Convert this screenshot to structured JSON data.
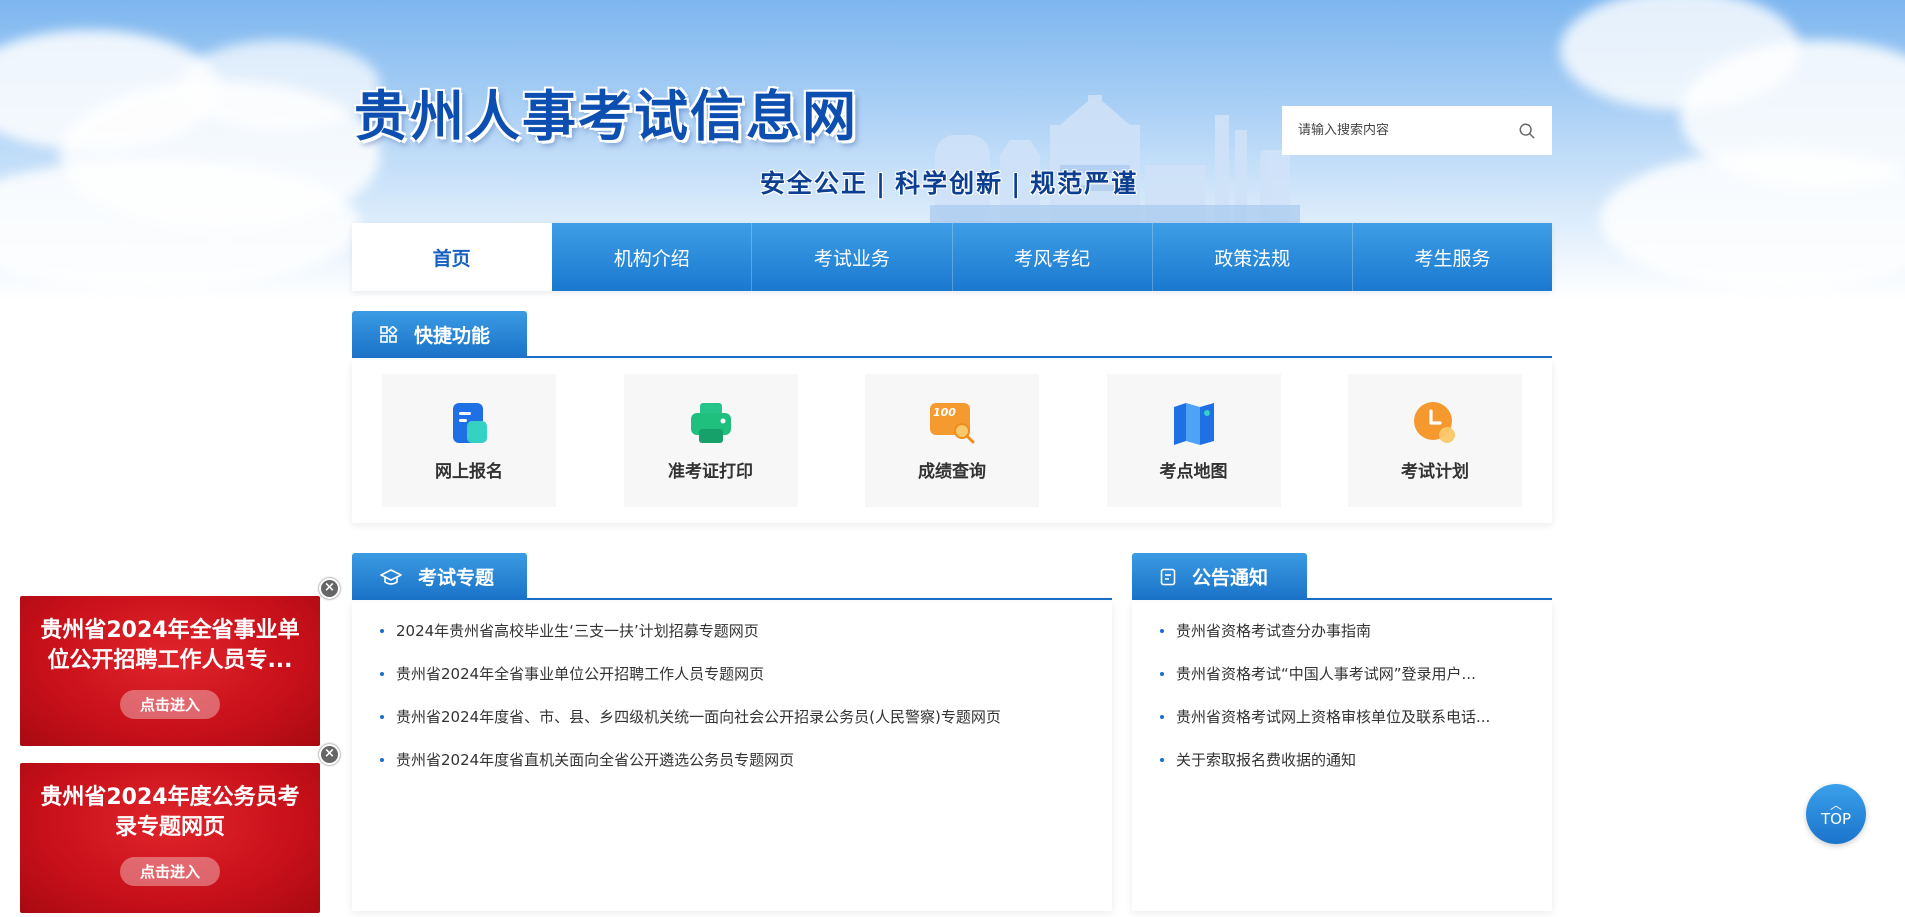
{
  "header": {
    "site_title": "贵州人事考试信息网",
    "slogan_1": "安全公正",
    "slogan_2": "科学创新",
    "slogan_3": "规范严谨",
    "slogan_sep": "|"
  },
  "search": {
    "placeholder": "请输入搜索内容",
    "icon": "search-icon"
  },
  "nav": {
    "items": [
      {
        "label": "首页",
        "active": true
      },
      {
        "label": "机构介绍"
      },
      {
        "label": "考试业务"
      },
      {
        "label": "考风考纪"
      },
      {
        "label": "政策法规"
      },
      {
        "label": "考生服务"
      }
    ]
  },
  "quick": {
    "title": "快捷功能",
    "icon": "grid-icon",
    "items": [
      {
        "label": "网上报名",
        "icon": "signup-icon"
      },
      {
        "label": "准考证打印",
        "icon": "printer-icon"
      },
      {
        "label": "成绩查询",
        "icon": "score-search-icon",
        "badge": "100"
      },
      {
        "label": "考点地图",
        "icon": "map-icon"
      },
      {
        "label": "考试计划",
        "icon": "clock-icon"
      }
    ]
  },
  "topics": {
    "title": "考试专题",
    "icon": "graduation-cap-icon",
    "items": [
      "2024年贵州省高校毕业生‘三支一扶’计划招募专题网页",
      "贵州省2024年全省事业单位公开招聘工作人员专题网页",
      "贵州省2024年度省、市、县、乡四级机关统一面向社会公开招录公务员(人民警察)专题网页",
      "贵州省2024年度省直机关面向全省公开遴选公务员专题网页"
    ]
  },
  "notices": {
    "title": "公告通知",
    "icon": "document-icon",
    "items": [
      "贵州省资格考试查分办事指南",
      "贵州省资格考试“中国人事考试网”登录用户...",
      "贵州省资格考试网上资格审核单位及联系电话...",
      "关于索取报名费收据的通知"
    ]
  },
  "ads": [
    {
      "title": "贵州省2024年全省事业单位公开招聘工作人员专...",
      "button": "点击进入"
    },
    {
      "title": "贵州省2024年度公务员考录专题网页",
      "button": "点击进入"
    }
  ],
  "top_button": {
    "label": "TOP"
  },
  "colors": {
    "primary": "#1a6fc8",
    "nav_active_text": "#1560c0",
    "ad_red": "#c8101a"
  }
}
